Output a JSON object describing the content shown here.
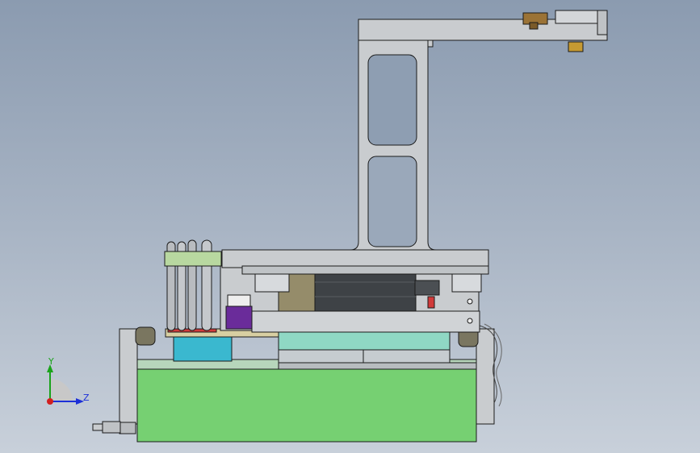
{
  "triad": {
    "y_label": "Y",
    "z_label": "Z",
    "y_color": "#1aa31a",
    "z_color": "#1c2fd8",
    "x_color": "#d21f1f"
  },
  "colors": {
    "background_top": "#8b9bb0",
    "background_bottom": "#c8d0da",
    "frame_gray": "#c9cccf",
    "base_green": "#76d072",
    "teal_block": "#3ab8cf",
    "mint_plate": "#8fd8c4",
    "purple_block": "#6a2c9a",
    "motor_dark": "#3e4246",
    "bracket_olive": "#958c6a",
    "brass": "#9b7336",
    "red_accent": "#d13a3a",
    "outline": "#1b1b1b"
  }
}
